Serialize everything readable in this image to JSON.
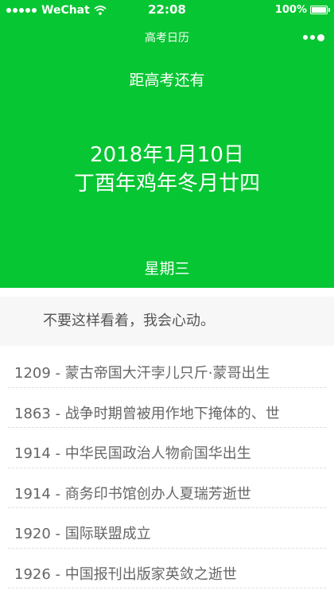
{
  "status_bar": {
    "carrier": "WeChat",
    "time": "22:08",
    "battery": "100%"
  },
  "nav": {
    "title": "高考日历"
  },
  "countdown": {
    "label": "距高考还有",
    "date": "2018年1月10日",
    "lunar_date": "丁酉年鸡年冬月廿四",
    "weekday": "星期三"
  },
  "quote": {
    "text": "不要这样看着，我会心动。"
  },
  "events": [
    {
      "year": "1209",
      "text": "蒙古帝国大汗孛儿只斤·蒙哥出生"
    },
    {
      "year": "1863",
      "text": "战争时期曾被用作地下掩体的、世"
    },
    {
      "year": "1914",
      "text": "中华民国政治人物俞国华出生"
    },
    {
      "year": "1914",
      "text": "商务印书馆创办人夏瑞芳逝世"
    },
    {
      "year": "1920",
      "text": "国际联盟成立"
    },
    {
      "year": "1926",
      "text": "中国报刊出版家英敛之逝世"
    }
  ],
  "colors": {
    "header_green": "#07c633",
    "quote_background": "#f7f7f7"
  }
}
